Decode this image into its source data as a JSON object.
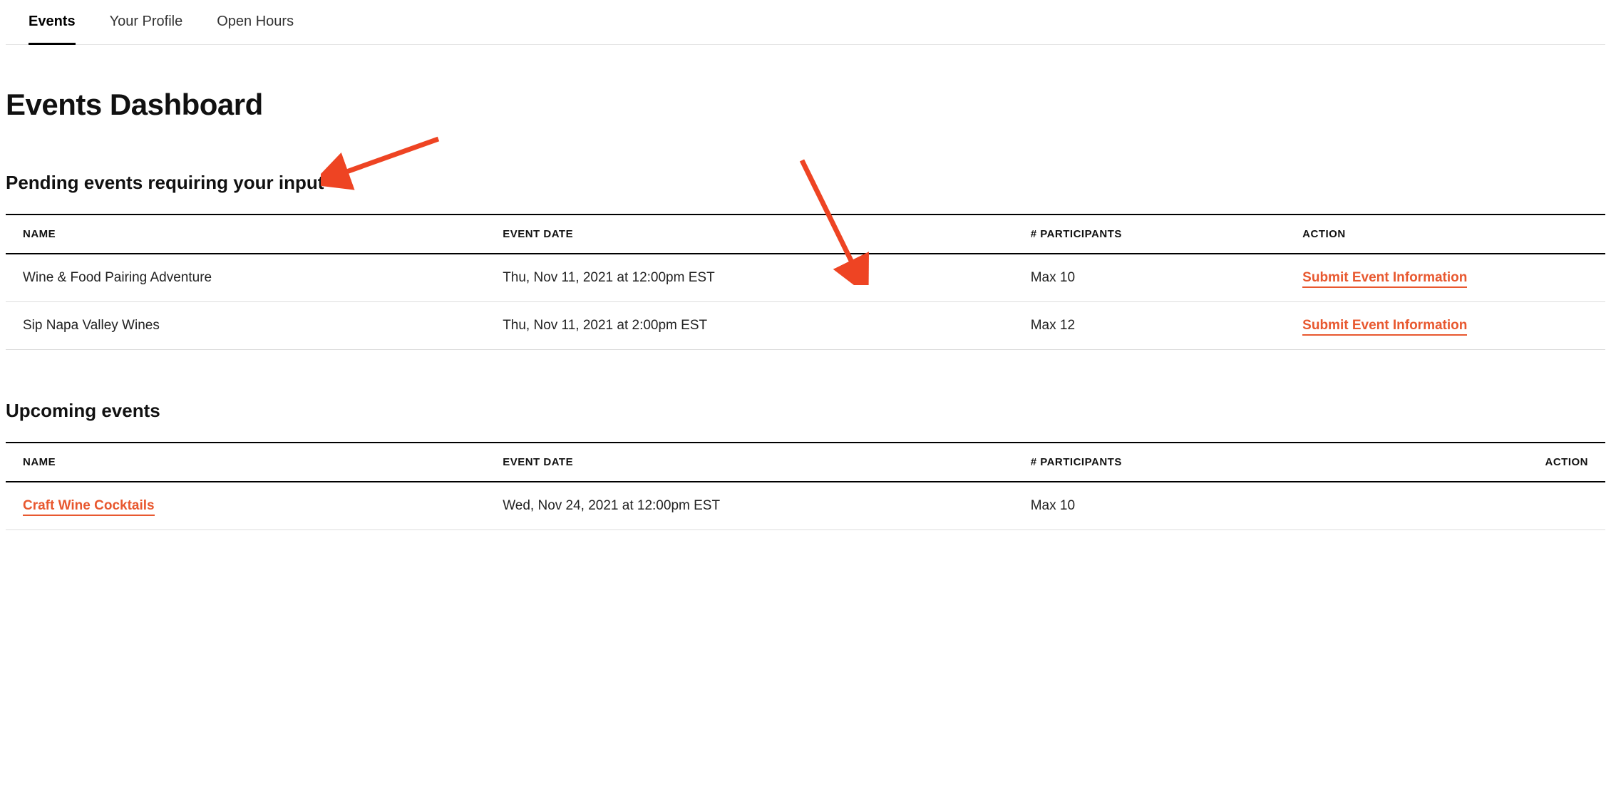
{
  "tabs": [
    {
      "label": "Events",
      "active": true
    },
    {
      "label": "Your Profile",
      "active": false
    },
    {
      "label": "Open Hours",
      "active": false
    }
  ],
  "page_title": "Events Dashboard",
  "sections": {
    "pending": {
      "title": "Pending events requiring your input",
      "headers": {
        "name": "NAME",
        "event_date": "EVENT DATE",
        "participants": "# PARTICIPANTS",
        "action": "ACTION"
      },
      "rows": [
        {
          "name": "Wine & Food Pairing Adventure",
          "event_date": "Thu, Nov 11, 2021 at 12:00pm EST",
          "participants": "Max 10",
          "action_label": "Submit Event Information"
        },
        {
          "name": "Sip Napa Valley Wines",
          "event_date": "Thu, Nov 11, 2021 at 2:00pm EST",
          "participants": "Max 12",
          "action_label": "Submit Event Information"
        }
      ]
    },
    "upcoming": {
      "title": "Upcoming events",
      "headers": {
        "name": "NAME",
        "event_date": "EVENT DATE",
        "participants": "# PARTICIPANTS",
        "action": "ACTION"
      },
      "rows": [
        {
          "name": "Craft Wine Cocktails",
          "event_date": "Wed, Nov 24, 2021 at 12:00pm EST",
          "participants": "Max 10",
          "action_label": ""
        }
      ]
    }
  },
  "annotation_color": "#ee4423"
}
